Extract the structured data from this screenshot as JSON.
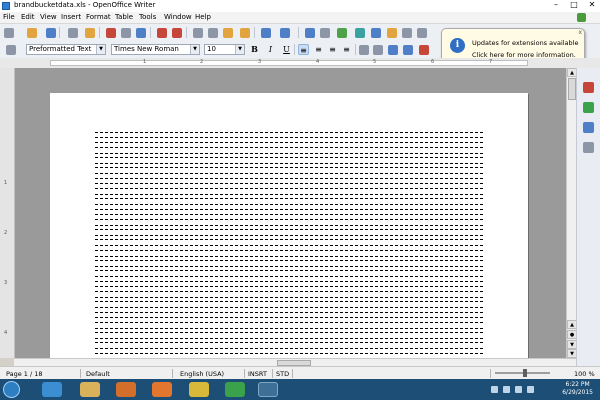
{
  "window": {
    "title": "brandbucketdata.xls - OpenOffice Writer",
    "controls": [
      "–",
      "□",
      "✕"
    ]
  },
  "menu": [
    "File",
    "Edit",
    "View",
    "Insert",
    "Format",
    "Table",
    "Tools",
    "Window",
    "Help"
  ],
  "format_toolbar": {
    "paragraph_style": "Preformatted Text",
    "font_name": "Times New Roman",
    "font_size": "10",
    "bold": "B",
    "italic": "I",
    "underline": "U"
  },
  "ruler": {
    "numbers": [
      "1",
      "2",
      "3",
      "4",
      "5",
      "6",
      "7"
    ]
  },
  "vruler": {
    "numbers": [
      "1",
      "2",
      "3",
      "4"
    ]
  },
  "document": {
    "line_count": 23
  },
  "notification": {
    "title": "Updates for extensions available",
    "message": "Click here for more information.",
    "icon": "i",
    "close": "x"
  },
  "status": {
    "page": "Page 1 / 18",
    "style": "Default",
    "language": "English (USA)",
    "insert_mode": "INSRT",
    "selection_mode": "STD",
    "zoom": "100 %"
  },
  "taskbar": {
    "apps": [
      "start-button",
      "internet-explorer",
      "file-explorer",
      "media-player",
      "firefox",
      "chrome",
      "openoffice-calc",
      "openoffice-writer"
    ],
    "time": "6:22 PM",
    "date": "6/29/2015"
  },
  "colors": {
    "accent": "#2e6ec4",
    "taskbar": "#1d4f76",
    "notification_bg": "#fffbe5"
  }
}
